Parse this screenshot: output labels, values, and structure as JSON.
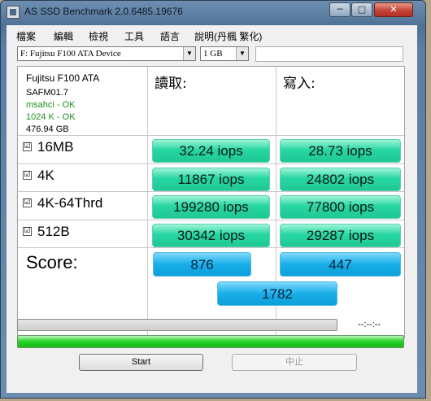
{
  "window": {
    "title": "AS SSD Benchmark 2.0.6485.19676"
  },
  "title_buttons": {
    "minimize": "─",
    "maximize": "□",
    "close": "✕"
  },
  "menu": [
    "檔案",
    "編輯",
    "檢視",
    "工具",
    "語言",
    "說明(丹楓 繁化)"
  ],
  "drive_select": {
    "value": "F: Fujitsu F100 ATA Device"
  },
  "size_select": {
    "value": "1 GB"
  },
  "drive_info": {
    "model": "Fujitsu F100 ATA",
    "firmware": "SAFM01.7",
    "driver_status": "msahci - OK",
    "alignment_status": "1024 K - OK",
    "capacity": "476.94 GB"
  },
  "columns": {
    "read": "讀取:",
    "write": "寫入:"
  },
  "tests": [
    {
      "label": "16MB",
      "checked": true,
      "read": "32.24 iops",
      "write": "28.73 iops"
    },
    {
      "label": "4K",
      "checked": true,
      "read": "11867 iops",
      "write": "24802 iops"
    },
    {
      "label": "4K-64Thrd",
      "checked": true,
      "read": "199280 iops",
      "write": "77800 iops"
    },
    {
      "label": "512B",
      "checked": true,
      "read": "30342 iops",
      "write": "29287 iops"
    }
  ],
  "check_mark": "☑",
  "score": {
    "label": "Score:",
    "read": "876",
    "write": "447",
    "total": "1782"
  },
  "progress": {
    "time": "--:--:--",
    "top_fill": 0,
    "bottom_fill": 1
  },
  "buttons": {
    "start": "Start",
    "stop": "中止"
  },
  "colors": {
    "result": "#28d6a3",
    "score": "#18aee8",
    "progress": "#27d127"
  }
}
